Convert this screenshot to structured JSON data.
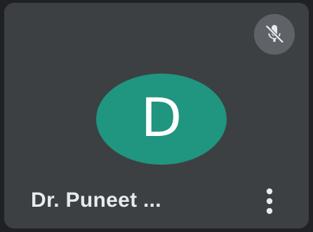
{
  "participant": {
    "initial": "D",
    "name": "Dr. Puneet ..."
  },
  "icons": {
    "mute_status": "mic-off-icon",
    "more_options": "more-vert-icon"
  },
  "colors": {
    "tile_background": "#3c4043",
    "avatar_background": "#20957f",
    "badge_background": "#5f6368",
    "text": "#e8eaed"
  }
}
